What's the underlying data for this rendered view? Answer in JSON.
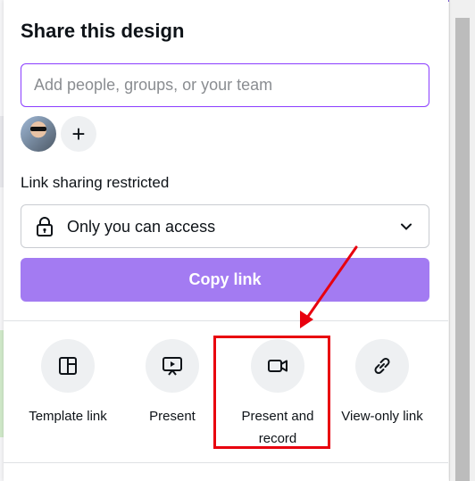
{
  "dialog": {
    "title": "Share this design",
    "invite_placeholder": "Add people, groups, or your team",
    "add_icon": "+",
    "link_sharing_label": "Link sharing restricted",
    "access_value": "Only you can access",
    "copy_link_label": "Copy link"
  },
  "share_options": [
    {
      "label": "Template link",
      "icon": "template-icon"
    },
    {
      "label": "Present",
      "icon": "present-icon"
    },
    {
      "label": "Present and record",
      "icon": "video-camera-icon"
    },
    {
      "label": "View-only link",
      "icon": "link-icon"
    }
  ],
  "colors": {
    "accent": "#8b3dff",
    "copy_button": "#a37bf2",
    "annotation": "#e8000e",
    "text": "#0e1318"
  }
}
